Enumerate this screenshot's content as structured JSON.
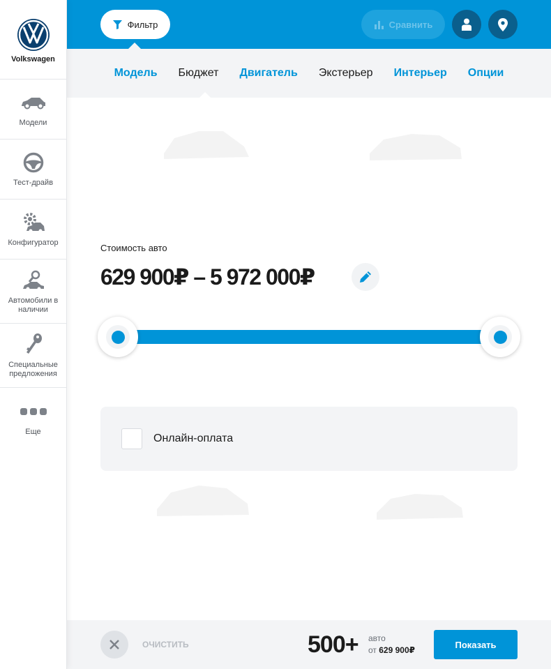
{
  "brand": {
    "name": "Volkswagen"
  },
  "colors": {
    "accent": "#0094d8",
    "dark_button": "#0a5f8d",
    "panel": "#f3f4f6"
  },
  "sidebar": {
    "items": [
      {
        "label": "Модели",
        "icon": "car-icon"
      },
      {
        "label": "Тест-драйв",
        "icon": "steering-wheel-icon"
      },
      {
        "label": "Конфигуратор",
        "icon": "configurator-gear-car-icon"
      },
      {
        "label": "Автомобили в наличии",
        "icon": "car-search-icon"
      },
      {
        "label": "Специальные предложения",
        "icon": "keys-icon"
      },
      {
        "label": "Еще",
        "icon": "more-dots-icon"
      }
    ]
  },
  "topbar": {
    "filter_label": "Фильтр",
    "compare_label": "Сравнить"
  },
  "tabs": [
    {
      "label": "Модель"
    },
    {
      "label": "Бюджет",
      "active": true
    },
    {
      "label": "Двигатель"
    },
    {
      "label": "Экстерьер"
    },
    {
      "label": "Интерьер"
    },
    {
      "label": "Опции"
    }
  ],
  "budget": {
    "label": "Стоимость авто",
    "range_text": "629 900₽ – 5 972 000₽",
    "slider_min_fraction": 0.0,
    "slider_max_fraction": 1.0
  },
  "online_payment": {
    "label": "Онлайн-оплата",
    "checked": false
  },
  "bottom": {
    "clear_label": "ОЧИСТИТЬ",
    "count": "500+",
    "count_unit": "авто",
    "from_prefix": "от",
    "from_price": "629 900₽",
    "show_label": "Показать"
  }
}
